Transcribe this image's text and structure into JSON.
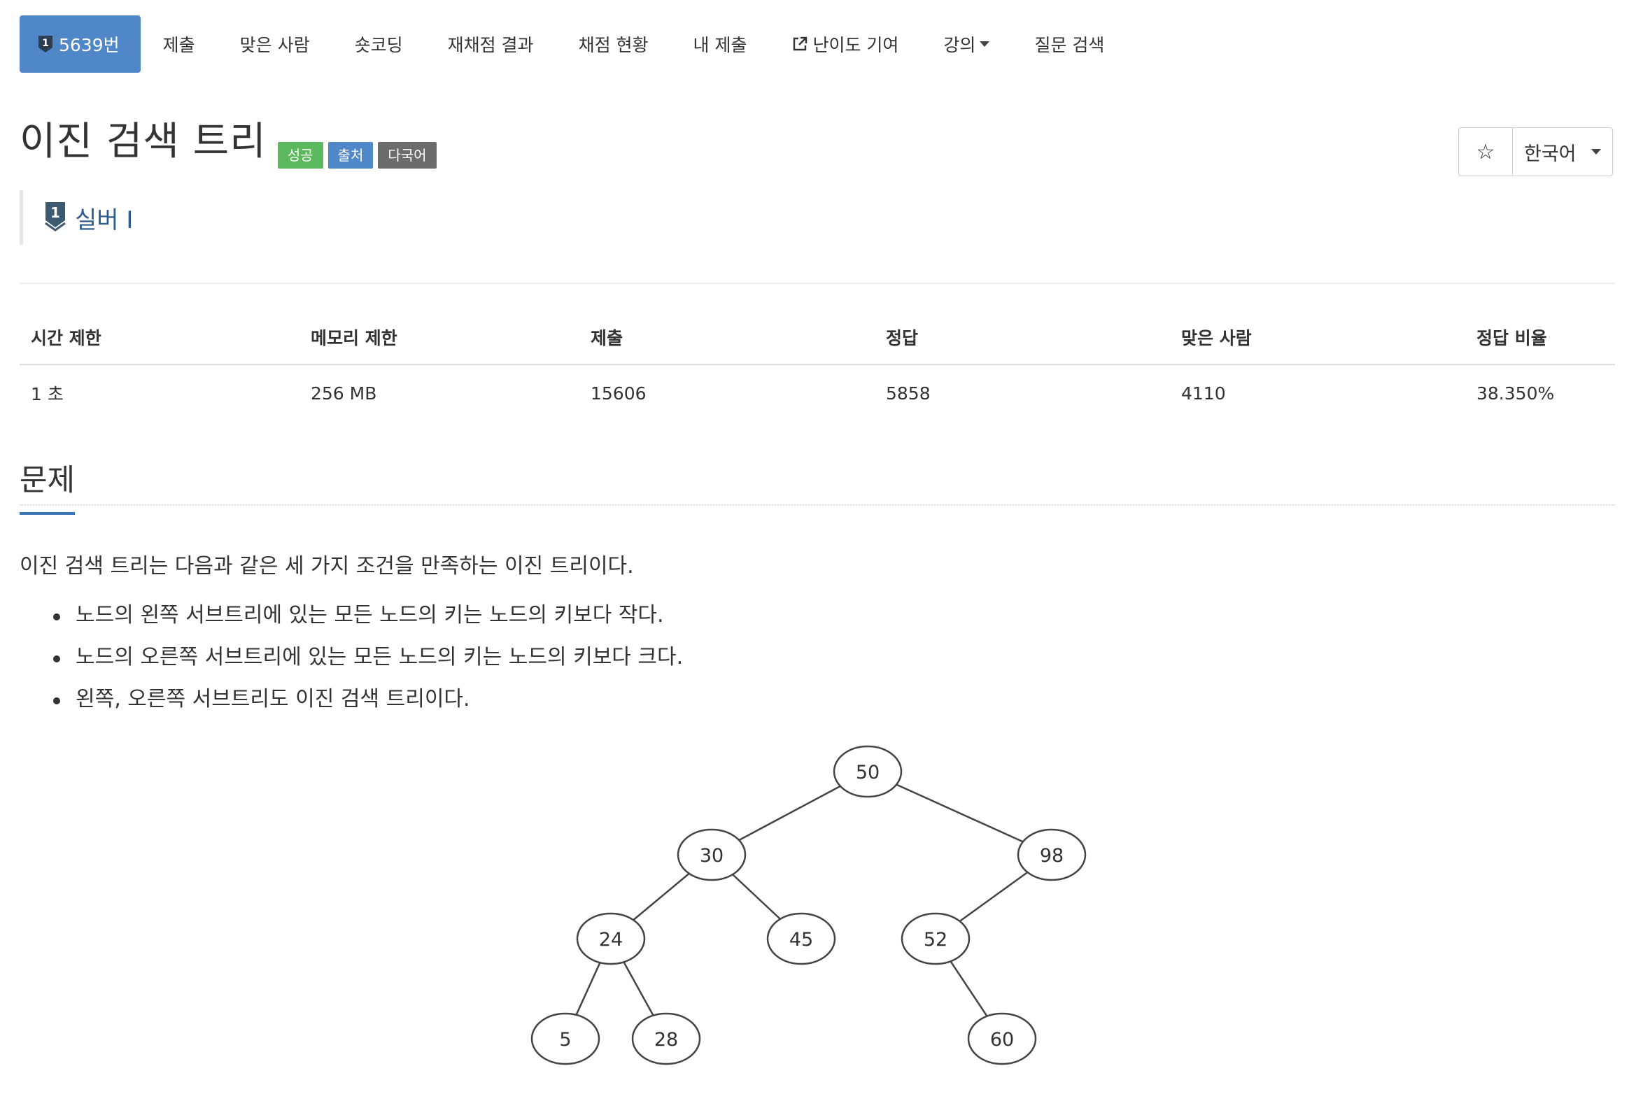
{
  "nav": {
    "problem_tab": "5639번",
    "tier_badge_number": "1",
    "items": [
      "제출",
      "맞은 사람",
      "숏코딩",
      "재채점 결과",
      "채점 현황",
      "내 제출",
      "난이도 기여",
      "강의",
      "질문 검색"
    ]
  },
  "problem": {
    "title": "이진 검색 트리",
    "labels": [
      "성공",
      "출처",
      "다국어"
    ],
    "tier": "실버 I",
    "tier_icon_number": "1"
  },
  "controls": {
    "star": "☆",
    "language": "한국어"
  },
  "info": {
    "headers": [
      "시간 제한",
      "메모리 제한",
      "제출",
      "정답",
      "맞은 사람",
      "정답 비율"
    ],
    "values": [
      "1 초",
      "256 MB",
      "15606",
      "5858",
      "4110",
      "38.350%"
    ]
  },
  "section": {
    "title": "문제",
    "statement": "이진 검색 트리는 다음과 같은 세 가지 조건을 만족하는 이진 트리이다.",
    "rules": [
      "노드의 왼쪽 서브트리에 있는 모든 노드의 키는 노드의 키보다 작다.",
      "노드의 오른쪽 서브트리에 있는 모든 노드의 키는 노드의 키보다 크다.",
      "왼쪽, 오른쪽 서브트리도 이진 검색 트리이다."
    ]
  },
  "tree": {
    "nodes": [
      "50",
      "30",
      "98",
      "24",
      "45",
      "52",
      "5",
      "28",
      "60"
    ],
    "edges": [
      [
        "50",
        "30"
      ],
      [
        "50",
        "98"
      ],
      [
        "30",
        "24"
      ],
      [
        "30",
        "45"
      ],
      [
        "98",
        "52"
      ],
      [
        "24",
        "5"
      ],
      [
        "24",
        "28"
      ],
      [
        "52",
        "60"
      ]
    ]
  },
  "colors": {
    "active_tab": "#4f87c8",
    "label_success": "#5cb85c",
    "label_primary": "#4f87c8",
    "label_default": "#6c6c6c",
    "tier_text": "#2f5d8f"
  }
}
